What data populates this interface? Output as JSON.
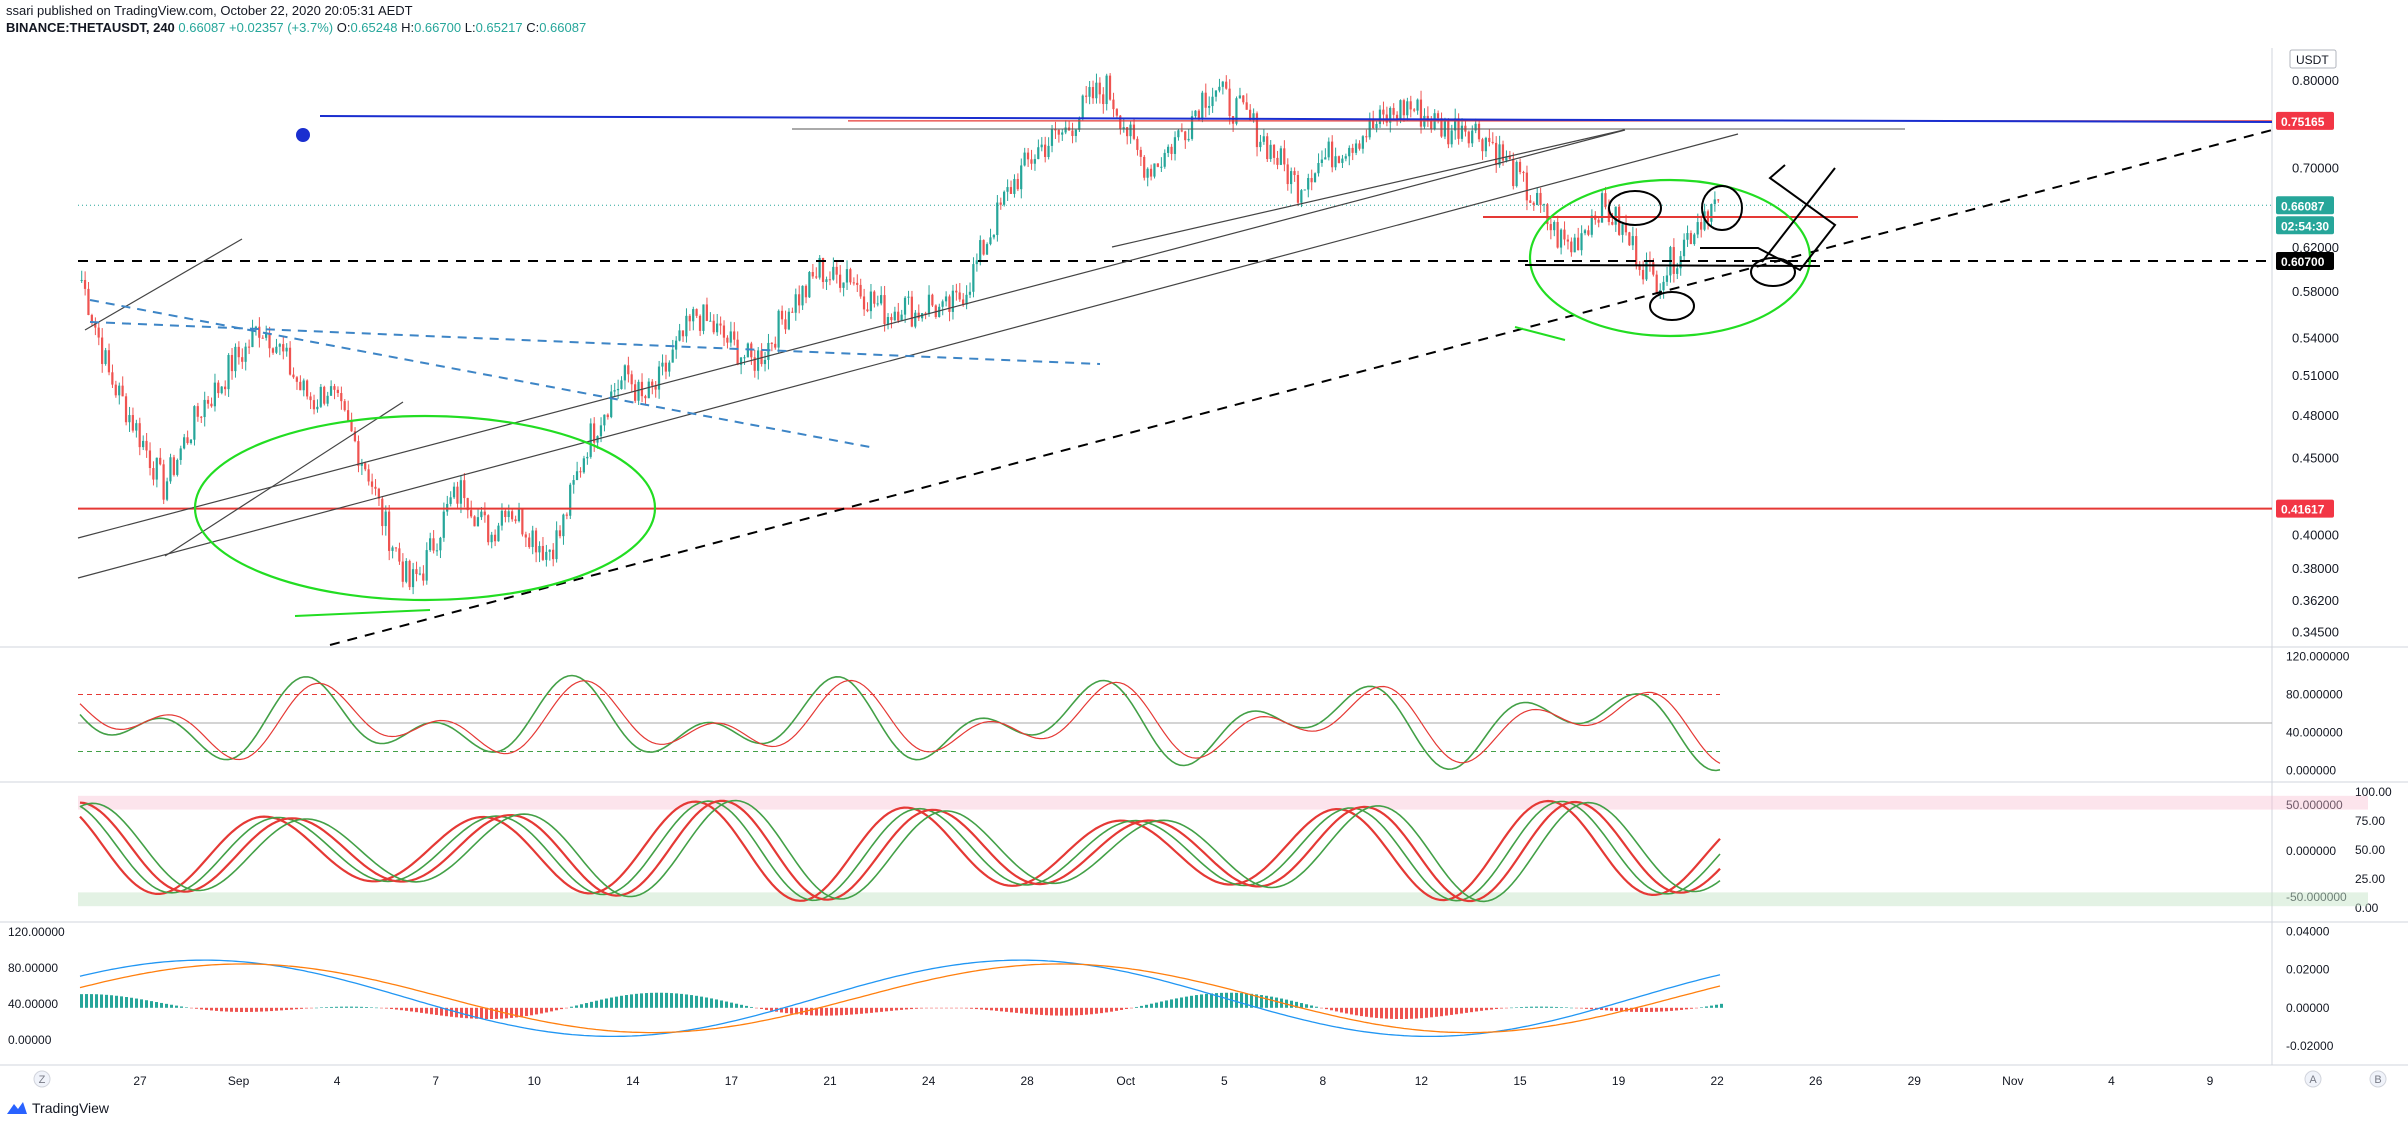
{
  "header": {
    "published": "ssari published on TradingView.com, October 22, 2020 20:05:31 AEDT",
    "symbol": "BINANCE:THETAUSDT, 240",
    "last": "0.66087",
    "change": "+0.02357 (+3.7%)",
    "o_label": "O:",
    "o": "0.65248",
    "h_label": "H:",
    "h": "0.66700",
    "l_label": "L:",
    "l": "0.65217",
    "c_label": "C:",
    "c": "0.66087"
  },
  "footer": {
    "logo_text": "TradingView"
  },
  "scale_buttons": {
    "z": "Z",
    "a": "A",
    "b": "B"
  },
  "currency": "USDT",
  "colors": {
    "up": "#26a69a",
    "down": "#ef5350",
    "blue_line": "#1a2ecf",
    "red_line": "#e53935",
    "dash_blue": "#3d85c6",
    "green_draw": "#22dd22",
    "badge_teal": "#26a69a",
    "badge_red": "#f23645",
    "badge_black": "#000000"
  },
  "chart_data": {
    "type": "candlestick",
    "x_ticks": [
      "27",
      "Sep",
      "4",
      "7",
      "10",
      "14",
      "17",
      "21",
      "24",
      "28",
      "Oct",
      "5",
      "8",
      "12",
      "15",
      "19",
      "22",
      "26",
      "29",
      "Nov",
      "4",
      "9"
    ],
    "price_axis": {
      "ticks": [
        "0.80000",
        "0.70000",
        "0.62000",
        "0.58000",
        "0.54000",
        "0.51000",
        "0.48000",
        "0.45000",
        "0.40000",
        "0.38000",
        "0.36200",
        "0.34500"
      ],
      "badges": [
        {
          "label": "0.75165",
          "color": "#f23645"
        },
        {
          "label": "0.66087",
          "color": "#26a69a"
        },
        {
          "label": "02:54:30",
          "color": "#26a69a"
        },
        {
          "label": "0.60700",
          "color": "#000000"
        },
        {
          "label": "0.41617",
          "color": "#f23645"
        }
      ],
      "log_scale": true
    },
    "price_path": [
      0.59,
      0.55,
      0.51,
      0.49,
      0.47,
      0.45,
      0.43,
      0.45,
      0.47,
      0.49,
      0.5,
      0.52,
      0.53,
      0.55,
      0.54,
      0.52,
      0.5,
      0.49,
      0.5,
      0.48,
      0.46,
      0.44,
      0.41,
      0.39,
      0.37,
      0.38,
      0.4,
      0.42,
      0.43,
      0.41,
      0.4,
      0.42,
      0.41,
      0.4,
      0.39,
      0.4,
      0.43,
      0.46,
      0.48,
      0.5,
      0.51,
      0.49,
      0.5,
      0.52,
      0.54,
      0.56,
      0.55,
      0.54,
      0.53,
      0.52,
      0.53,
      0.55,
      0.57,
      0.58,
      0.6,
      0.59,
      0.6,
      0.58,
      0.57,
      0.56,
      0.57,
      0.56,
      0.57,
      0.56,
      0.57,
      0.59,
      0.62,
      0.65,
      0.68,
      0.7,
      0.72,
      0.73,
      0.74,
      0.76,
      0.78,
      0.79,
      0.76,
      0.72,
      0.7,
      0.71,
      0.73,
      0.75,
      0.78,
      0.79,
      0.77,
      0.76,
      0.74,
      0.72,
      0.7,
      0.68,
      0.7,
      0.71,
      0.72,
      0.73,
      0.74,
      0.75,
      0.76,
      0.77,
      0.76,
      0.75,
      0.74,
      0.75,
      0.74,
      0.73,
      0.71,
      0.69,
      0.67,
      0.65,
      0.63,
      0.62,
      0.64,
      0.66,
      0.65,
      0.63,
      0.61,
      0.59,
      0.6,
      0.62,
      0.64,
      0.66
    ],
    "indicator_1": {
      "ticks": [
        "120.000000",
        "80.000000",
        "40.000000",
        "0.000000"
      ],
      "levels": [
        80,
        20
      ]
    },
    "indicator_2": {
      "left_ticks": [
        "50.000000",
        "0.000000",
        "-50.000000"
      ],
      "right_ticks": [
        "100.00",
        "75.00",
        "50.00",
        "25.00",
        "0.00"
      ]
    },
    "indicator_3": {
      "left_ticks": [
        "120.00000",
        "80.00000",
        "40.00000",
        "0.00000"
      ],
      "right_ticks": [
        "0.04000",
        "0.02000",
        "0.00000",
        "-0.02000"
      ]
    }
  }
}
